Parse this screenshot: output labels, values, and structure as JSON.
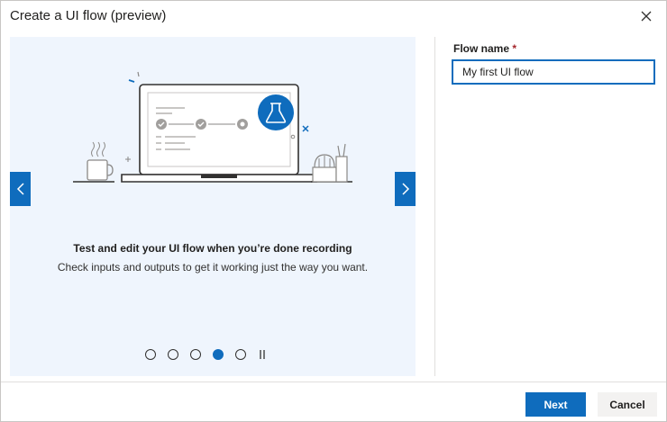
{
  "dialog": {
    "title": "Create a UI flow (preview)",
    "close_icon": "close-icon"
  },
  "carousel": {
    "slide_heading": "Test and edit your UI flow when you’re done recording",
    "slide_body": "Check inputs and outputs to get it working just the way you want.",
    "prev_icon": "chevron-left-icon",
    "next_icon": "chevron-right-icon",
    "total_slides": 5,
    "active_slide": 4,
    "pause_icon": "pause-icon"
  },
  "form": {
    "flow_name_label": "Flow name",
    "required_marker": "*",
    "flow_name_value": "My first UI flow"
  },
  "footer": {
    "next_label": "Next",
    "cancel_label": "Cancel"
  },
  "colors": {
    "accent": "#0f6cbd",
    "carousel_bg": "#eff5fd",
    "required": "#a4262c"
  }
}
